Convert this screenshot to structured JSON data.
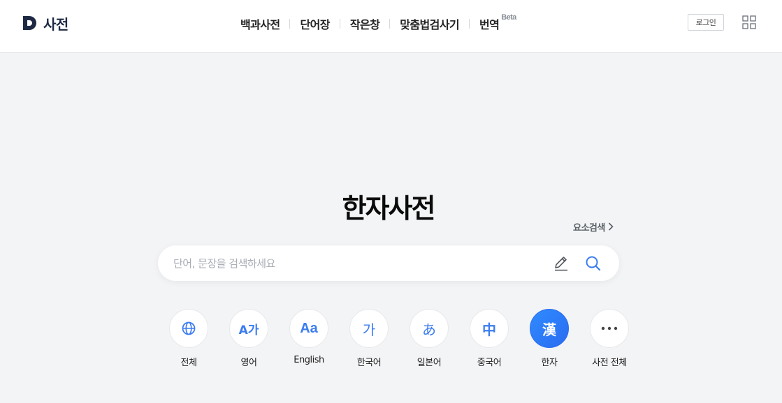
{
  "header": {
    "logo_text": "사전",
    "nav": [
      {
        "label": "백과사전"
      },
      {
        "label": "단어장"
      },
      {
        "label": "작은창"
      },
      {
        "label": "맞춤법검사기"
      },
      {
        "label": "번역",
        "badge": "Beta"
      }
    ],
    "login_label": "로그인"
  },
  "main": {
    "title": "한자사전",
    "element_search_label": "요소검색",
    "search": {
      "placeholder": "단어, 문장을 검색하세요",
      "value": ""
    },
    "categories": [
      {
        "label": "전체",
        "icon": "globe-icon",
        "glyph": ""
      },
      {
        "label": "영어",
        "icon": "english-korean-icon",
        "glyph": "A가"
      },
      {
        "label": "English",
        "icon": "english-icon",
        "glyph": "Aa"
      },
      {
        "label": "한국어",
        "icon": "korean-icon",
        "glyph": "가"
      },
      {
        "label": "일본어",
        "icon": "japanese-icon",
        "glyph": "あ"
      },
      {
        "label": "중국어",
        "icon": "chinese-icon",
        "glyph": "中"
      },
      {
        "label": "한자",
        "icon": "hanja-icon",
        "glyph": "漢",
        "active": true
      },
      {
        "label": "사전 전체",
        "icon": "more-icon",
        "glyph": ""
      }
    ]
  },
  "colors": {
    "accent": "#2a6cf0",
    "icon_blue": "#3b7cf0",
    "background": "#f3f4f6",
    "logo": "#1e2a44"
  }
}
